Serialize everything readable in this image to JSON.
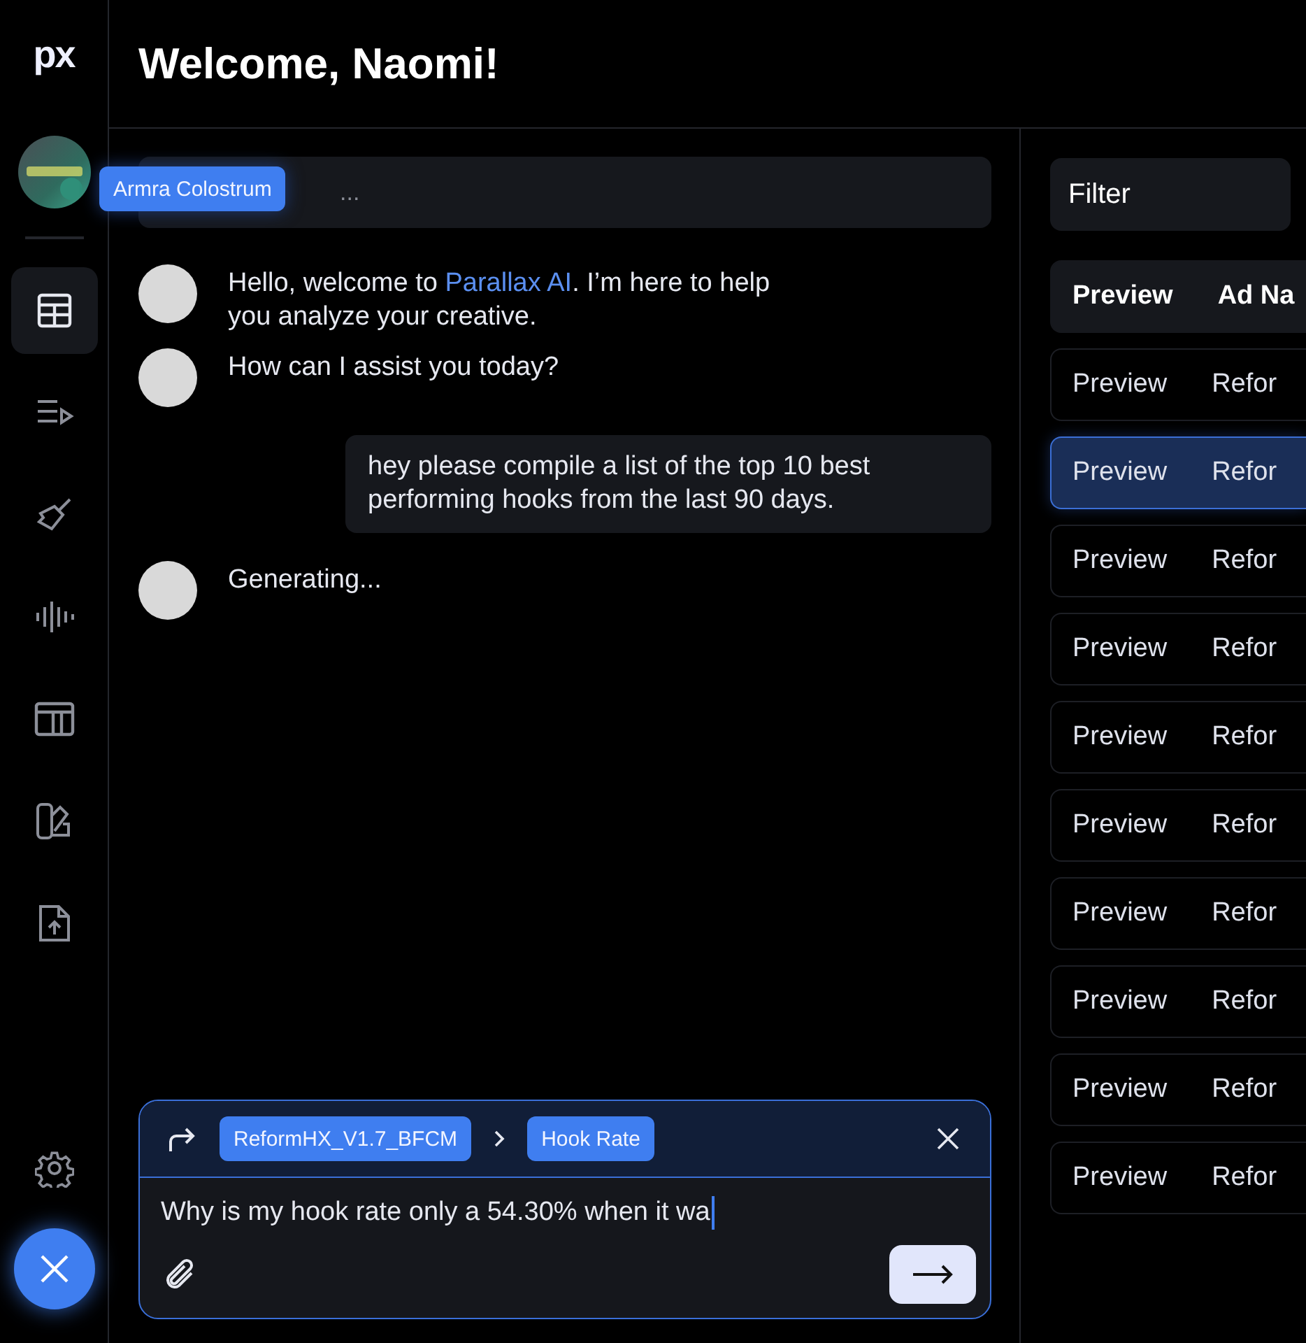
{
  "brand": {
    "logo": "px"
  },
  "header": {
    "title": "Welcome, Naomi!"
  },
  "sidebar": {
    "items": [
      {
        "kind": "table",
        "selected": true
      },
      {
        "kind": "playlist",
        "selected": false
      },
      {
        "kind": "brush",
        "selected": false
      },
      {
        "kind": "wave",
        "selected": false
      },
      {
        "kind": "layout",
        "selected": false
      },
      {
        "kind": "swatch",
        "selected": false
      },
      {
        "kind": "upload",
        "selected": false
      }
    ]
  },
  "brand_selector": {
    "chip": "Armra Colostrum",
    "trailing": "..."
  },
  "messages": [
    {
      "kind": "assistant",
      "segments": [
        {
          "text": "Hello, welcome to "
        },
        {
          "text": "Parallax AI",
          "kind": "link"
        },
        {
          "text": ". I’m here to help you analyze your creative."
        }
      ]
    },
    {
      "kind": "assistant",
      "segments": [
        {
          "text": "How can I assist you today?"
        }
      ]
    },
    {
      "kind": "user",
      "segments": [
        {
          "text": "hey please compile a list of the top 10 best performing hooks from the last 90 days."
        }
      ]
    },
    {
      "kind": "assistant",
      "segments": [
        {
          "text": "Generating..."
        }
      ]
    }
  ],
  "composer": {
    "context": [
      "ReformHX_V1.7_BFCM",
      "Hook Rate"
    ],
    "value": "Why is my hook rate only a 54.30% when it wa"
  },
  "panel": {
    "filter": "Filter",
    "columns": [
      "Preview",
      "Ad Na"
    ],
    "rows": [
      {
        "cells": [
          "Preview",
          "Refor"
        ],
        "selected": false
      },
      {
        "cells": [
          "Preview",
          "Refor"
        ],
        "selected": true
      },
      {
        "cells": [
          "Preview",
          "Refor"
        ],
        "selected": false
      },
      {
        "cells": [
          "Preview",
          "Refor"
        ],
        "selected": false
      },
      {
        "cells": [
          "Preview",
          "Refor"
        ],
        "selected": false
      },
      {
        "cells": [
          "Preview",
          "Refor"
        ],
        "selected": false
      },
      {
        "cells": [
          "Preview",
          "Refor"
        ],
        "selected": false
      },
      {
        "cells": [
          "Preview",
          "Refor"
        ],
        "selected": false
      },
      {
        "cells": [
          "Preview",
          "Refor"
        ],
        "selected": false
      },
      {
        "cells": [
          "Preview",
          "Refor"
        ],
        "selected": false
      }
    ]
  }
}
